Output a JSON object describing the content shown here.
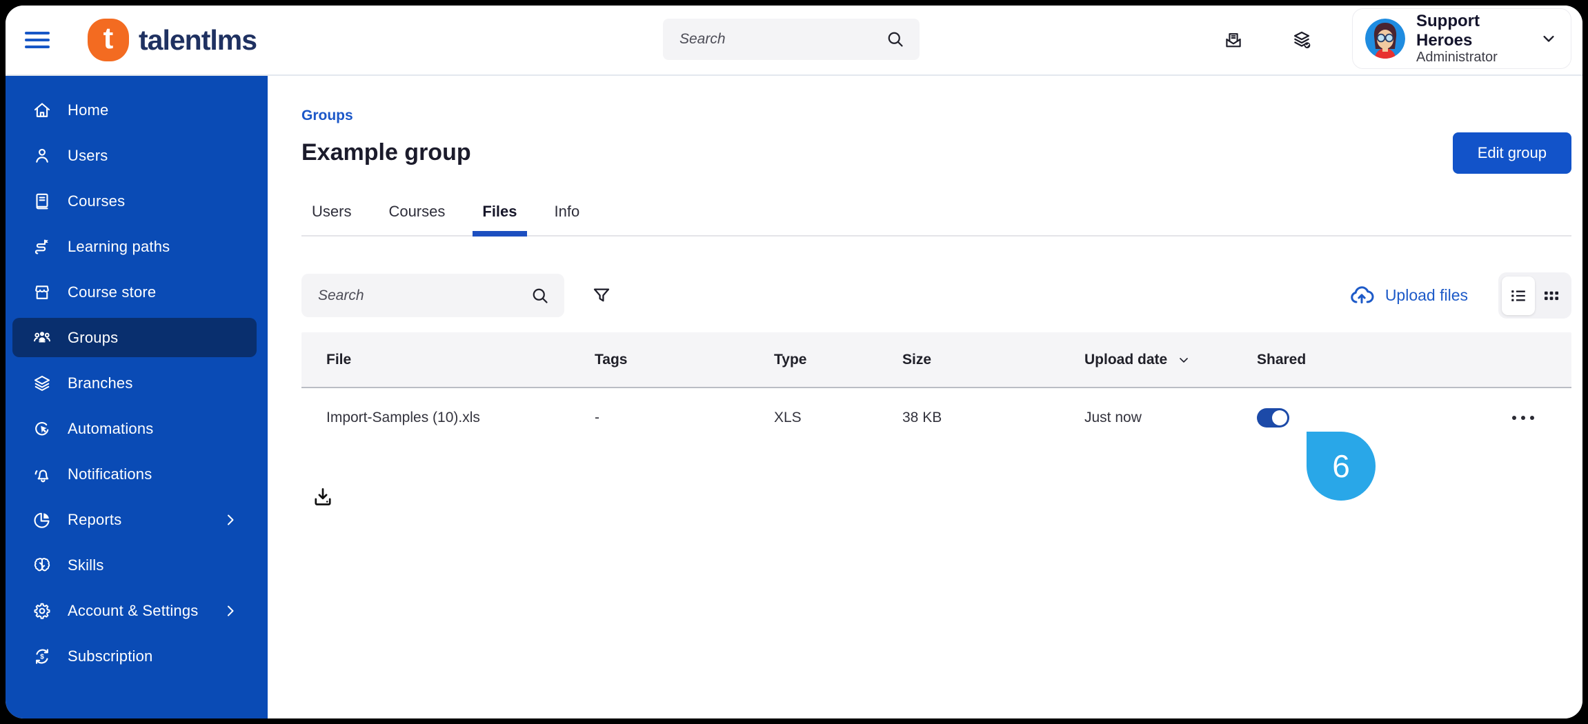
{
  "header": {
    "logo_letter": "t",
    "logo_text": "talentlms",
    "search": {
      "placeholder": "Search"
    },
    "user": {
      "name": "Support Heroes",
      "role": "Administrator"
    }
  },
  "sidebar": {
    "items": [
      {
        "label": "Home"
      },
      {
        "label": "Users"
      },
      {
        "label": "Courses"
      },
      {
        "label": "Learning paths"
      },
      {
        "label": "Course store"
      },
      {
        "label": "Groups",
        "selected": true
      },
      {
        "label": "Branches"
      },
      {
        "label": "Automations"
      },
      {
        "label": "Notifications"
      },
      {
        "label": "Reports",
        "expandable": true
      },
      {
        "label": "Skills"
      },
      {
        "label": "Account & Settings",
        "expandable": true
      },
      {
        "label": "Subscription"
      }
    ]
  },
  "main": {
    "breadcrumb": "Groups",
    "title": "Example group",
    "edit_group_button": "Edit group",
    "tabs": [
      {
        "label": "Users"
      },
      {
        "label": "Courses"
      },
      {
        "label": "Files",
        "active": true
      },
      {
        "label": "Info"
      }
    ],
    "toolbar": {
      "search_placeholder": "Search",
      "upload_label": "Upload files"
    },
    "table": {
      "columns": [
        "File",
        "Tags",
        "Type",
        "Size",
        "Upload date",
        "Shared"
      ],
      "rows": [
        {
          "file": "Import-Samples (10).xls",
          "tags": "-",
          "type": "XLS",
          "size": "38 KB",
          "upload_date": "Just now",
          "shared": true
        }
      ]
    },
    "annotation": {
      "step_number": "6"
    }
  },
  "colors": {
    "sidebar_blue": "#0a4bb5",
    "sidebar_selected": "#092f6e",
    "accent_blue": "#1b57c8",
    "button_blue": "#1253c9",
    "toggle_on": "#1c4aa8",
    "annotation_blue": "#29a7e8",
    "logo_orange": "#f36b21",
    "logo_navy": "#1f3161"
  }
}
